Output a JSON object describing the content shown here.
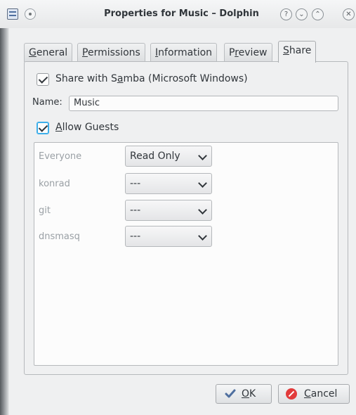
{
  "window": {
    "title": "Properties for Music – Dolphin"
  },
  "tabs": [
    {
      "label_pre": "",
      "mnemonic": "G",
      "label_post": "eneral"
    },
    {
      "label_pre": "",
      "mnemonic": "P",
      "label_post": "ermissions"
    },
    {
      "label_pre": "",
      "mnemonic": "I",
      "label_post": "nformation"
    },
    {
      "label_pre": "P",
      "mnemonic": "r",
      "label_post": "eview"
    },
    {
      "label_pre": "",
      "mnemonic": "S",
      "label_post": "hare"
    }
  ],
  "share": {
    "samba_pre": "Share with S",
    "samba_mnemonic": "a",
    "samba_post": "mba (Microsoft Windows)",
    "samba_checked": true,
    "name_label": "Name:",
    "name_value": "Music",
    "guests_pre": "",
    "guests_mnemonic": "A",
    "guests_post": "llow Guests",
    "guests_checked": true
  },
  "permissions": [
    {
      "user": "Everyone",
      "value": "Read Only"
    },
    {
      "user": "konrad",
      "value": "---"
    },
    {
      "user": "git",
      "value": "---"
    },
    {
      "user": "dnsmasq",
      "value": "---"
    }
  ],
  "buttons": {
    "ok_mnemonic": "O",
    "ok_post": "K",
    "cancel_mnemonic": "C",
    "cancel_post": "ancel"
  },
  "colors": {
    "accent": "#3daee9",
    "cancel_icon": "#e23b3b",
    "ok_icon": "#4f6f9f"
  }
}
